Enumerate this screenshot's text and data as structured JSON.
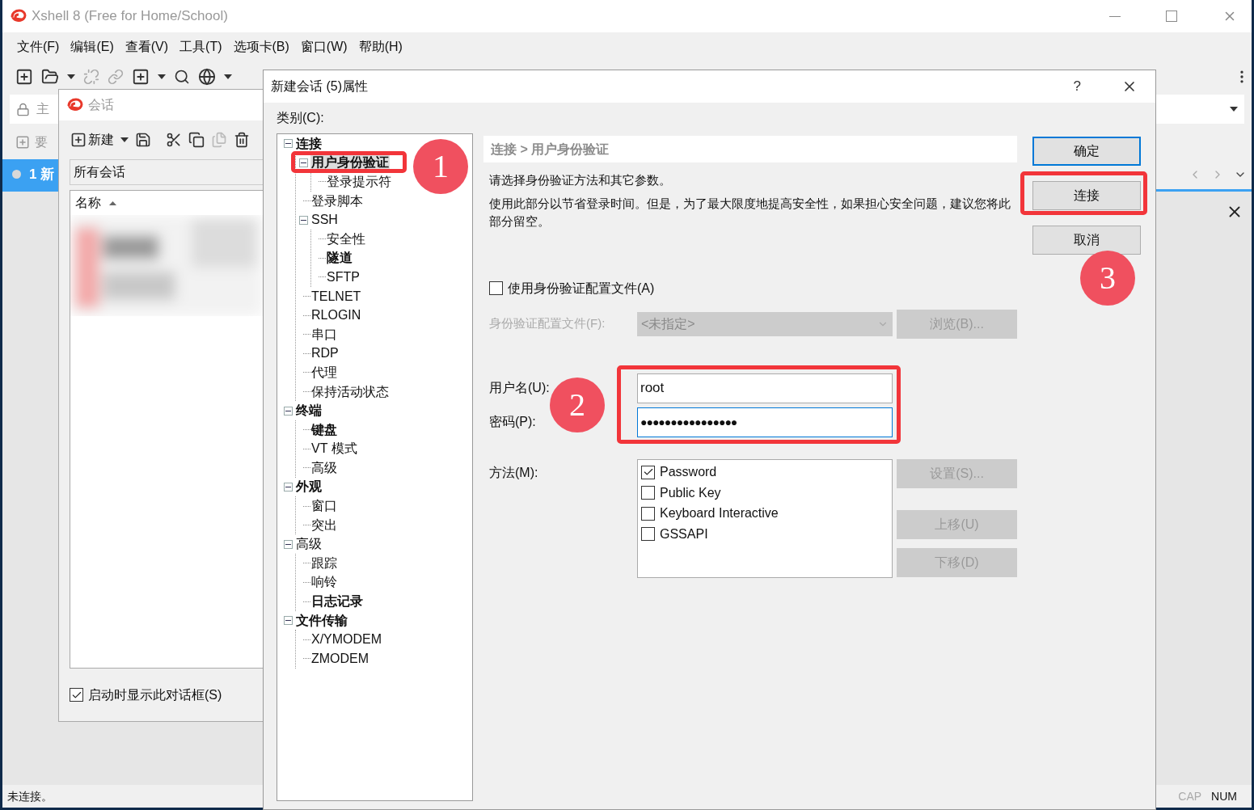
{
  "app": {
    "title": "Xshell 8 (Free for Home/School)",
    "menu": [
      "文件(F)",
      "编辑(E)",
      "查看(V)",
      "工具(T)",
      "选项卡(B)",
      "窗口(W)",
      "帮助(H)"
    ],
    "address_text": "主",
    "hint_text": "要",
    "tabs": [
      {
        "label": "1 新",
        "selected": true
      }
    ],
    "status": "未连接。",
    "indicators": [
      {
        "label": "CAP",
        "on": false
      },
      {
        "label": "NUM",
        "on": true
      }
    ]
  },
  "sessions": {
    "title": "会话",
    "new_label": "新建",
    "folder": "所有会话",
    "column": "名称",
    "show_on_startup": {
      "label": "启动时显示此对话框(S)",
      "checked": true
    }
  },
  "properties": {
    "title": "新建会话 (5)属性",
    "help": "?",
    "category_label": "类别(C):",
    "tree": [
      {
        "label": "连接",
        "bold": true,
        "selected": false,
        "expanded": true,
        "children": [
          {
            "label": "用户身份验证",
            "bold": true,
            "selected": true,
            "expanded": true,
            "children": [
              {
                "label": "登录提示符",
                "bold": false,
                "selected": false
              }
            ]
          },
          {
            "label": "登录脚本",
            "bold": false,
            "selected": false
          },
          {
            "label": "SSH",
            "bold": false,
            "selected": false,
            "expanded": true,
            "children": [
              {
                "label": "安全性",
                "bold": false,
                "selected": false
              },
              {
                "label": "隧道",
                "bold": true,
                "selected": false
              },
              {
                "label": "SFTP",
                "bold": false,
                "selected": false
              }
            ]
          },
          {
            "label": "TELNET",
            "bold": false,
            "selected": false
          },
          {
            "label": "RLOGIN",
            "bold": false,
            "selected": false
          },
          {
            "label": "串口",
            "bold": false,
            "selected": false
          },
          {
            "label": "RDP",
            "bold": false,
            "selected": false
          },
          {
            "label": "代理",
            "bold": false,
            "selected": false
          },
          {
            "label": "保持活动状态",
            "bold": false,
            "selected": false
          }
        ]
      },
      {
        "label": "终端",
        "bold": true,
        "selected": false,
        "expanded": true,
        "children": [
          {
            "label": "键盘",
            "bold": true,
            "selected": false
          },
          {
            "label": "VT 模式",
            "bold": false,
            "selected": false
          },
          {
            "label": "高级",
            "bold": false,
            "selected": false
          }
        ]
      },
      {
        "label": "外观",
        "bold": true,
        "selected": false,
        "expanded": true,
        "children": [
          {
            "label": "窗口",
            "bold": false,
            "selected": false
          },
          {
            "label": "突出",
            "bold": false,
            "selected": false
          }
        ]
      },
      {
        "label": "高级",
        "bold": false,
        "selected": false,
        "expanded": true,
        "children": [
          {
            "label": "跟踪",
            "bold": false,
            "selected": false
          },
          {
            "label": "响铃",
            "bold": false,
            "selected": false
          },
          {
            "label": "日志记录",
            "bold": true,
            "selected": false
          }
        ]
      },
      {
        "label": "文件传输",
        "bold": true,
        "selected": false,
        "expanded": true,
        "children": [
          {
            "label": "X/YMODEM",
            "bold": false,
            "selected": false
          },
          {
            "label": "ZMODEM",
            "bold": false,
            "selected": false
          }
        ]
      }
    ],
    "breadcrumb": "连接 > 用户身份验证",
    "intro": "请选择身份验证方法和其它参数。",
    "note": "使用此部分以节省登录时间。但是，为了最大限度地提高安全性，如果担心安全问题，建议您将此部分留空。",
    "use_profile": {
      "label": "使用身份验证配置文件(A)",
      "checked": false
    },
    "profile_label": "身份验证配置文件(F):",
    "profile_value": "<未指定>",
    "browse": {
      "label": "浏览(B)...",
      "disabled": true
    },
    "username_label": "用户名(U):",
    "username": "root",
    "password_label": "密码(P):",
    "password": "●●●●●●●●●●●●●●●●",
    "method_label": "方法(M):",
    "methods": [
      {
        "label": "Password",
        "checked": true
      },
      {
        "label": "Public Key",
        "checked": false
      },
      {
        "label": "Keyboard Interactive",
        "checked": false
      },
      {
        "label": "GSSAPI",
        "checked": false
      }
    ],
    "method_buttons": [
      {
        "label": "设置(S)...",
        "disabled": true
      },
      {
        "label": "上移(U)",
        "disabled": true
      },
      {
        "label": "下移(D)",
        "disabled": true
      }
    ],
    "buttons": [
      {
        "label": "确定",
        "selected": true
      },
      {
        "label": "连接",
        "selected": false
      },
      {
        "label": "取消",
        "selected": false
      }
    ]
  },
  "annotations": [
    {
      "label": "1"
    },
    {
      "label": "2"
    },
    {
      "label": "3"
    }
  ]
}
